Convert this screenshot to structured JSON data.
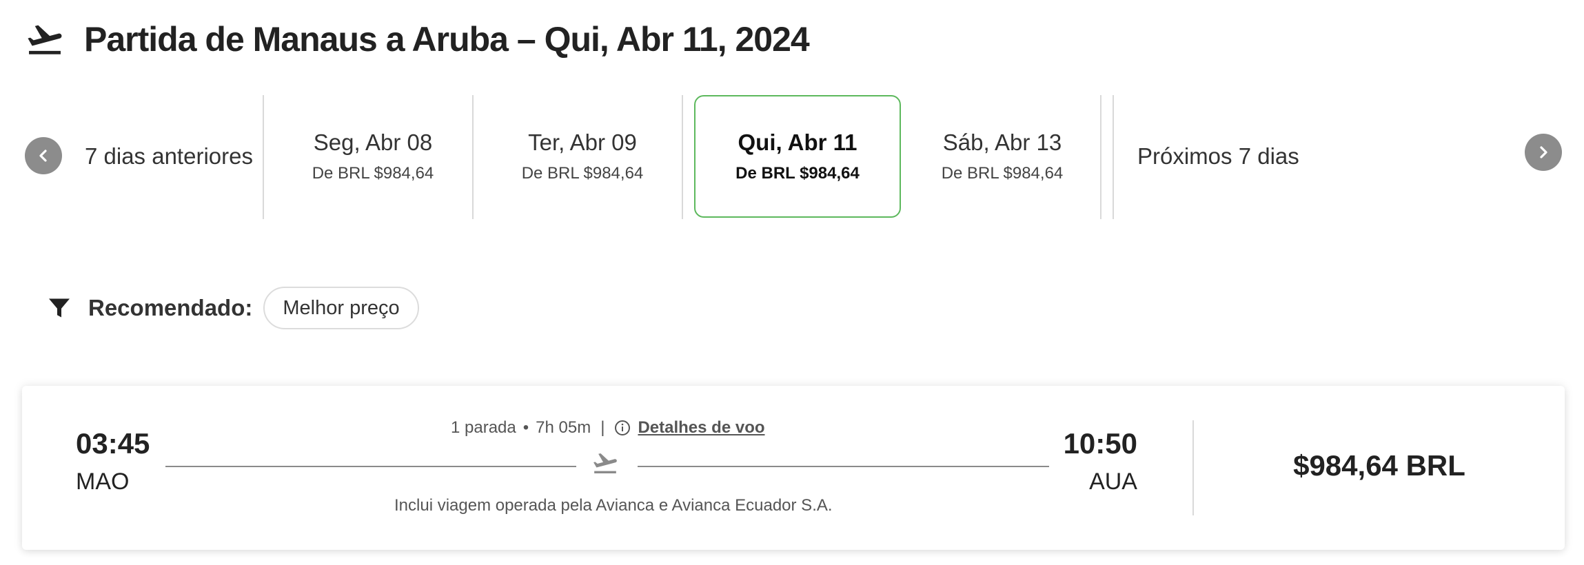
{
  "header": {
    "icon": "plane-departure-icon",
    "title": "Partida de Manaus a Aruba – Qui, Abr 11, 2024"
  },
  "date_nav": {
    "prev_label": "7 dias anteriores",
    "next_label": "Próximos 7 dias",
    "dates": [
      {
        "day": "Seg, Abr 08",
        "price": "De BRL $984,64",
        "selected": false
      },
      {
        "day": "Ter, Abr 09",
        "price": "De BRL $984,64",
        "selected": false
      },
      {
        "day": "Qui, Abr 11",
        "price": "De BRL $984,64",
        "selected": true
      },
      {
        "day": "Sáb, Abr 13",
        "price": "De BRL $984,64",
        "selected": false
      }
    ],
    "selected_border_color": "#5cb85c"
  },
  "filter": {
    "icon": "funnel-icon",
    "label": "Recomendado:",
    "chip": "Melhor preço"
  },
  "flight": {
    "departure_time": "03:45",
    "departure_code": "MAO",
    "arrival_time": "10:50",
    "arrival_code": "AUA",
    "stops": "1 parada",
    "bullet": "•",
    "duration": "7h 05m",
    "separator": "|",
    "details_link": "Detalhes de voo",
    "operated_by": "Inclui viagem operada pela Avianca e Avianca Ecuador S.A.",
    "price": "$984,64 BRL"
  }
}
